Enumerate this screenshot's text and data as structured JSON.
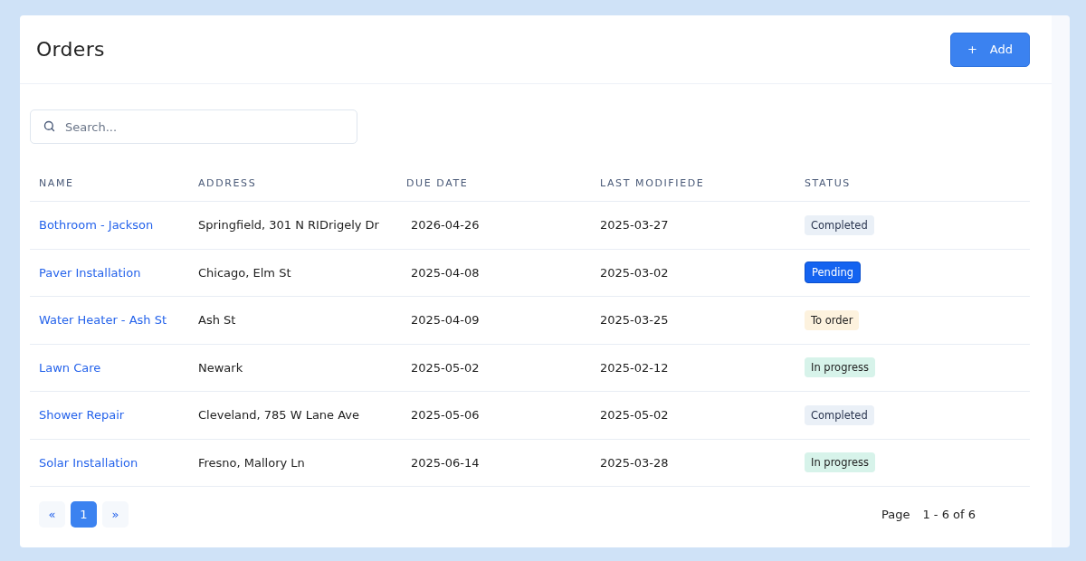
{
  "title": "Orders",
  "add_button": {
    "icon": "+",
    "label": "Add"
  },
  "search": {
    "placeholder": "Search..."
  },
  "table": {
    "columns": [
      "NAME",
      "ADDRESS",
      "DUE DATE",
      "LAST MODIFIEDE",
      "STATUS"
    ],
    "rows": [
      {
        "name": "Bothroom - Jackson",
        "address": "Springfield, 301 N RIDrigely Dr",
        "due_date": "2026-04-26",
        "last_modified": "2025-03-27",
        "status": {
          "label": "Completed",
          "kind": "completed"
        }
      },
      {
        "name": "Paver Installation",
        "address": "Chicago, Elm St",
        "due_date": "2025-04-08",
        "last_modified": "2025-03-02",
        "status": {
          "label": "Pending",
          "kind": "pending"
        }
      },
      {
        "name": "Water Heater - Ash St",
        "address": "Ash St",
        "due_date": "2025-04-09",
        "last_modified": "2025-03-25",
        "status": {
          "label": "To order",
          "kind": "to_order"
        }
      },
      {
        "name": "Lawn Care",
        "address": "Newark",
        "due_date": "2025-05-02",
        "last_modified": "2025-02-12",
        "status": {
          "label": "In progress",
          "kind": "in_progress"
        }
      },
      {
        "name": "Shower Repair",
        "address": "Cleveland, 785 W Lane Ave",
        "due_date": "2025-05-06",
        "last_modified": "2025-05-02",
        "status": {
          "label": "Completed",
          "kind": "completed"
        }
      },
      {
        "name": "Solar Installation",
        "address": "Fresno, Mallory Ln",
        "due_date": "2025-06-14",
        "last_modified": "2025-03-28",
        "status": {
          "label": "In progress",
          "kind": "in_progress"
        }
      }
    ]
  },
  "pagination": {
    "prev": "«",
    "pages": [
      {
        "label": "1",
        "selected": true
      }
    ],
    "next": "»",
    "page_label": "Page",
    "range": "1 - 6 of 6"
  }
}
